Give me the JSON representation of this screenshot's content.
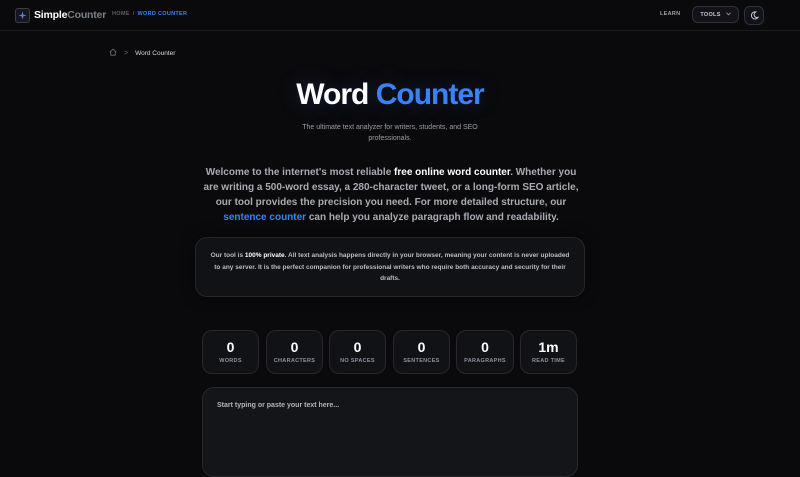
{
  "header": {
    "brand_primary": "Simple",
    "brand_secondary": "Counter",
    "breadcrumb_home": "HOME",
    "breadcrumb_sep": "/",
    "breadcrumb_current": "WORD COUNTER",
    "nav_learn": "LEARN",
    "tools_label": "TOOLS",
    "logo_icon": "sparkle-icon",
    "theme_icon": "moon-icon"
  },
  "breadcrumb": {
    "home_icon": "home-icon",
    "separator": ">",
    "current": "Word Counter"
  },
  "hero": {
    "title_part1": "Word",
    "title_part2": "Counter",
    "subtitle": "The ultimate text analyzer for writers, students, and SEO professionals."
  },
  "intro": {
    "p1": "Welcome to the internet's most reliable ",
    "p1_strong": "free online word counter",
    "p2": ". Whether you are writing a 500-word essay, a 280-character tweet, or a long-form SEO article, our tool provides the precision you need. For more detailed structure, our ",
    "link": "sentence counter",
    "p3": " can help you analyze paragraph flow and readability."
  },
  "privacy": {
    "p1": "Our tool is ",
    "strong": "100% private",
    "p2": ". All text analysis happens directly in your browser, meaning your content is never uploaded to any server. It is the perfect companion for professional writers who require both accuracy and security for their drafts."
  },
  "stats": [
    {
      "value": "0",
      "label": "WORDS"
    },
    {
      "value": "0",
      "label": "CHARACTERS"
    },
    {
      "value": "0",
      "label": "NO SPACES"
    },
    {
      "value": "0",
      "label": "SENTENCES"
    },
    {
      "value": "0",
      "label": "PARAGRAPHS"
    },
    {
      "value": "1m",
      "label": "READ TIME"
    }
  ],
  "editor": {
    "placeholder": "Start typing or paste your text here...",
    "value": ""
  },
  "colors": {
    "accent": "#3b82f6",
    "background": "#0a0a0c",
    "card": "#111216"
  }
}
